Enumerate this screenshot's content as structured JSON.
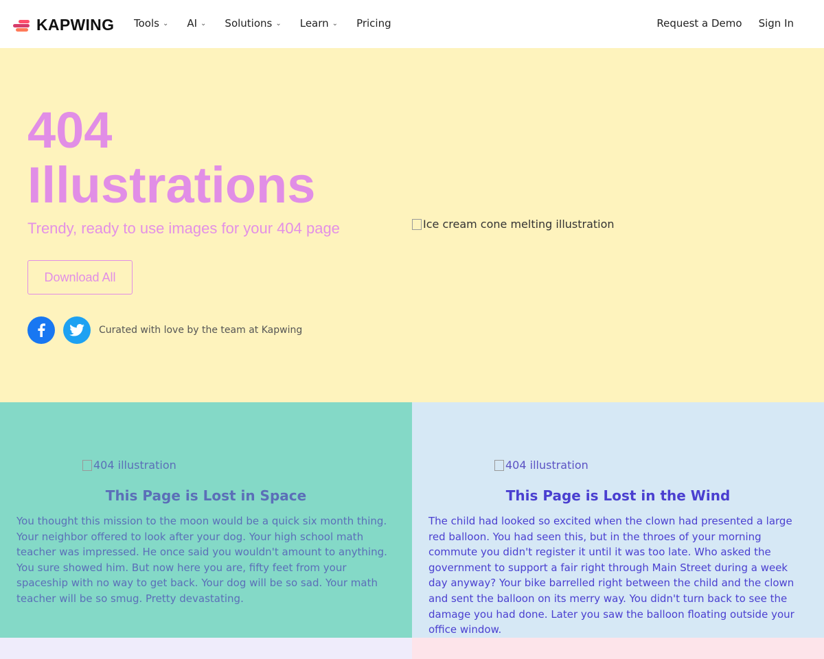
{
  "nav": {
    "brand": "KAPWING",
    "items": [
      {
        "label": "Tools",
        "has_menu": true
      },
      {
        "label": "AI",
        "has_menu": true
      },
      {
        "label": "Solutions",
        "has_menu": true
      },
      {
        "label": "Learn",
        "has_menu": true
      },
      {
        "label": "Pricing",
        "has_menu": false
      }
    ],
    "request_demo": "Request a Demo",
    "sign_in": "Sign In"
  },
  "hero": {
    "title_line1": "404",
    "title_line2": "Illustrations",
    "subtitle": "Trendy, ready to use images for your 404 page",
    "download_label": "Download All",
    "curated": "Curated with love by the team at Kapwing",
    "image_alt": "Ice cream cone melting illustration",
    "bg_color": "#fef3bd",
    "accent_color": "#e18ee6"
  },
  "cards": [
    {
      "image_alt": "404 illustration",
      "title": "This Page is Lost in Space",
      "text": "You thought this mission to the moon would be a quick six month thing. Your neighbor offered to look after your dog. Your high school math teacher was impressed. He once said you wouldn't amount to anything. You sure showed him. But now here you are, fifty feet from your spaceship with no way to get back. Your dog will be so sad. Your math teacher will be so smug. Pretty devastating.",
      "bg_color": "#84d9c7"
    },
    {
      "image_alt": "404 illustration",
      "title": "This Page is Lost in the Wind",
      "text": "The child had looked so excited when the clown had presented a large red balloon. You had seen this, but in the throes of your morning commute you didn't register it until it was too late. Who asked the government to support a fair right through Main Street during a week day anyway? Your bike barrelled right between the child and the clown and sent the balloon on its merry way. You didn't turn back to see the damage you had done. Later you saw the balloon floating outside your office window.",
      "bg_color": "#d6e8f5"
    }
  ],
  "icons": {
    "chevron": "chevron-down-icon",
    "facebook": "facebook-icon",
    "twitter": "twitter-icon",
    "broken_image": "broken-image-icon"
  }
}
